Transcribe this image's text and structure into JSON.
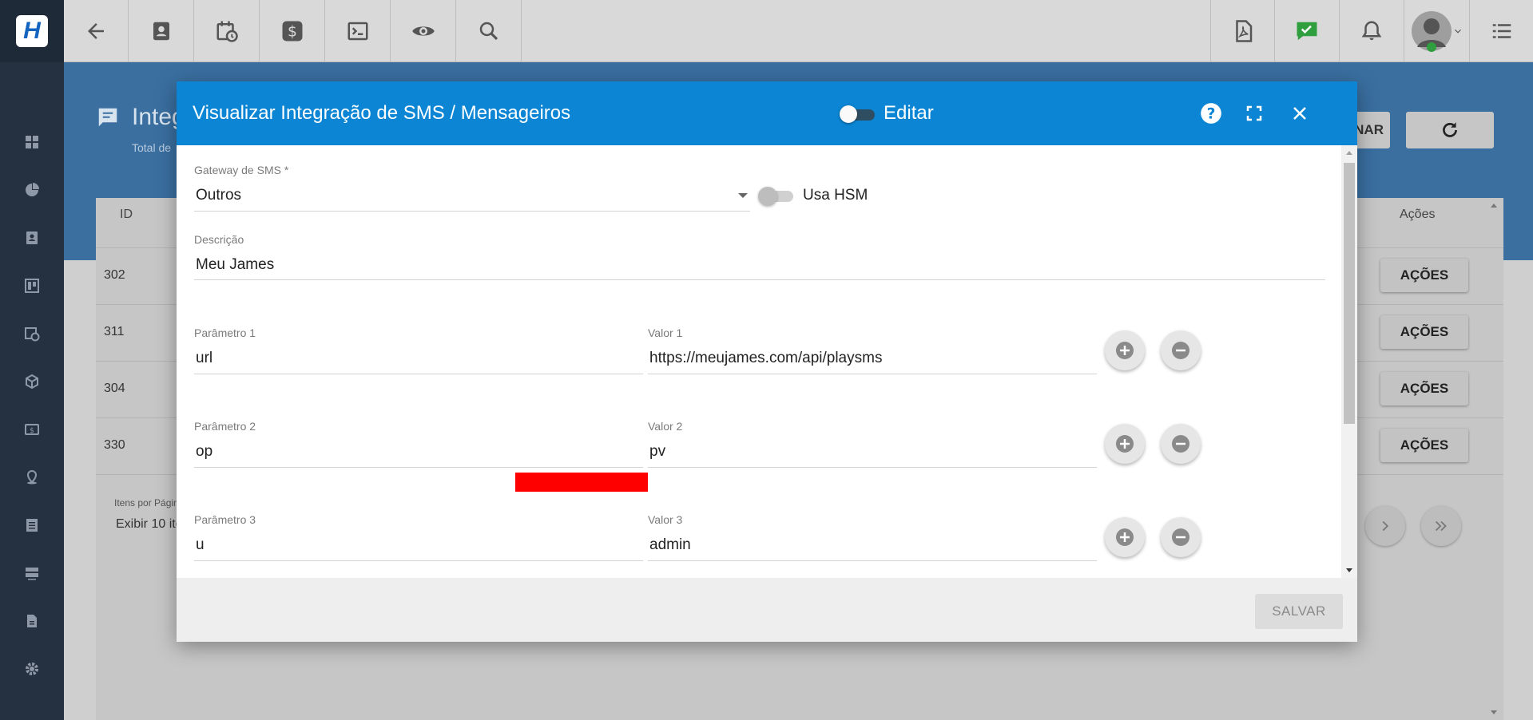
{
  "sidebar": {
    "items": [
      {
        "icon": "dashboard-icon"
      },
      {
        "icon": "pie-chart-icon"
      },
      {
        "icon": "contact-card-icon"
      },
      {
        "icon": "kanban-board-icon"
      },
      {
        "icon": "calendar-clock-icon"
      },
      {
        "icon": "box-icon"
      },
      {
        "icon": "money-icon"
      },
      {
        "icon": "location-icon"
      },
      {
        "icon": "document-list-icon"
      },
      {
        "icon": "server-icon"
      },
      {
        "icon": "file-text-icon"
      },
      {
        "icon": "settings-icon"
      }
    ]
  },
  "topbar": {
    "icons": [
      "back-arrow-icon",
      "contact-icon",
      "calendar-clock-icon",
      "dollar-icon",
      "terminal-icon",
      "eye-icon",
      "search-icon",
      "pdf-icon",
      "chat-check-icon",
      "bell-icon",
      "avatar",
      "menu-list-icon"
    ]
  },
  "background": {
    "title": "Integ",
    "subtitle": "Total de",
    "partial_button": "NAR",
    "columns": {
      "id": "ID",
      "actions": "Ações"
    },
    "rows": [
      {
        "id": "302",
        "action": "AÇÕES"
      },
      {
        "id": "311",
        "action": "AÇÕES"
      },
      {
        "id": "304",
        "action": "AÇÕES"
      },
      {
        "id": "330",
        "action": "AÇÕES"
      }
    ],
    "pagination": {
      "label": "Itens por Págin",
      "value": "Exibir 10 ite"
    }
  },
  "modal": {
    "title": "Visualizar Integração de SMS / Mensageiros",
    "edit_toggle_label": "Editar",
    "edit_toggle_on": false,
    "gateway": {
      "label": "Gateway de SMS *",
      "value": "Outros"
    },
    "hsm_toggle_label": "Usa HSM",
    "hsm_toggle_on": false,
    "description": {
      "label": "Descrição",
      "value": "Meu James"
    },
    "params": [
      {
        "param_label": "Parâmetro 1",
        "param_value": "url",
        "value_label": "Valor 1",
        "value_value": "https://meujames.com/api/playsms"
      },
      {
        "param_label": "Parâmetro 2",
        "param_value": "op",
        "value_label": "Valor 2",
        "value_value": "pv"
      },
      {
        "param_label": "Parâmetro 3",
        "param_value": "u",
        "value_label": "Valor 3",
        "value_value": "admin"
      }
    ],
    "save_label": "SALVAR"
  },
  "colors": {
    "header_blue": "#0b85d4",
    "sidebar": "#253040",
    "redaction": "#ff0000"
  }
}
